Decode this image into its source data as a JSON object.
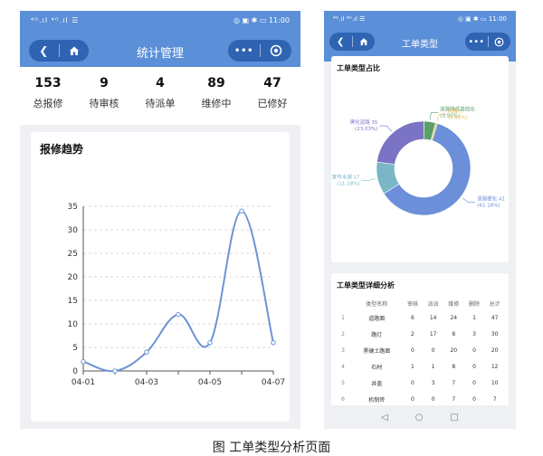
{
  "left": {
    "status": {
      "signal": "⁴ᴳ.ıl ⁴ᴳ.ıl ☰",
      "right": "◎ ▣ ✱ ▭ 11:00"
    },
    "title": "统计管理",
    "stats": [
      {
        "value": "153",
        "label": "总报修"
      },
      {
        "value": "9",
        "label": "待审核"
      },
      {
        "value": "4",
        "label": "待派单"
      },
      {
        "value": "89",
        "label": "维修中"
      },
      {
        "value": "47",
        "label": "已修好"
      }
    ],
    "chart_title": "报修趋势"
  },
  "right": {
    "status": {
      "signal": "⁴ᴳ.ıl ⁴ᴳ.ıl ☰",
      "right": "◎ ▣ ✱ ▭ 11:00"
    },
    "title": "工单类型",
    "pie_title": "工单类型占比",
    "table_title": "工单类型详细分析",
    "table": {
      "headers": [
        "",
        "类型名称",
        "审核",
        "派派",
        "维修",
        "删除",
        "总计"
      ],
      "rows": [
        [
          "1",
          "道路面",
          "6",
          "14",
          "24",
          "1",
          "47"
        ],
        [
          "2",
          "路灯",
          "2",
          "17",
          "8",
          "3",
          "30"
        ],
        [
          "3",
          "黑硬土路面",
          "0",
          "0",
          "20",
          "0",
          "20"
        ],
        [
          "4",
          "石材",
          "1",
          "1",
          "8",
          "0",
          "12"
        ],
        [
          "5",
          "井盖",
          "0",
          "3",
          "7",
          "0",
          "10"
        ],
        [
          "6",
          "机制砖",
          "0",
          "0",
          "7",
          "0",
          "7"
        ]
      ]
    },
    "sysnav": {
      "back": "◁",
      "home": "○",
      "recent": "□"
    }
  },
  "chart_data": [
    {
      "type": "line",
      "title": "报修趋势",
      "x": [
        "04-01",
        "04-02",
        "04-03",
        "04-04",
        "04-05",
        "04-06",
        "04-07"
      ],
      "x_tick_labels": [
        "04-01",
        "04-03",
        "04-05",
        "04-07"
      ],
      "series": [
        {
          "values": [
            2,
            0,
            4,
            12,
            6,
            34,
            6
          ]
        }
      ],
      "ylim": [
        0,
        35
      ],
      "yticks": [
        0,
        5,
        10,
        15,
        20,
        25,
        30,
        35
      ],
      "grid": true,
      "color": "#6d94d6"
    },
    {
      "type": "pie",
      "title": "工单类型占比",
      "donut": true,
      "slices": [
        {
          "name": "道路硬化",
          "value": 61.18,
          "label": "道路硬化 41\n(61.18%)",
          "color": "#6b8fd8"
        },
        {
          "name": "宣传水湖",
          "value": 11.18,
          "label": "宣传水湖 17\n(11.18%)",
          "color": "#79b6c6"
        },
        {
          "name": "黑化道路",
          "value": 23.03,
          "label": "黑化道路 35\n(23.03%)",
          "color": "#7b74c4"
        },
        {
          "name": "道路降低",
          "value": 3.95,
          "label": "道路降低简档化\n(3.95%)",
          "color": "#5aa06a"
        },
        {
          "name": "闲置",
          "value": 0.66,
          "label": "闲置 1\n(0.66%)",
          "color": "#e4c35a"
        }
      ]
    }
  ],
  "caption": "图 工单类型分析页面"
}
